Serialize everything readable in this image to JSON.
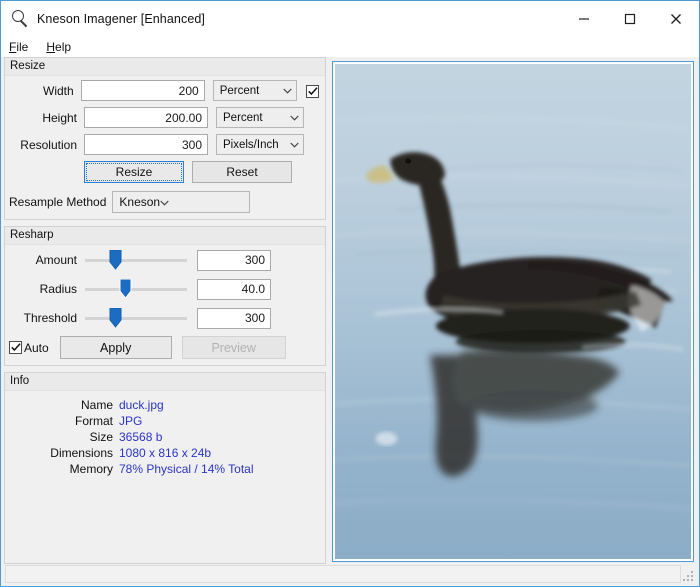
{
  "window": {
    "title": "Kneson Imagener [Enhanced]",
    "icon": "magnifier-icon",
    "controls": {
      "minimize": "minimize",
      "maximize": "maximize",
      "close": "close"
    }
  },
  "menubar": {
    "items": [
      {
        "label": "File",
        "mnemonic": "F"
      },
      {
        "label": "Help",
        "mnemonic": "H"
      }
    ]
  },
  "resize_panel": {
    "title": "Resize",
    "fields": [
      {
        "label": "Width",
        "value": "200",
        "unit": "Percent"
      },
      {
        "label": "Height",
        "value": "200.00",
        "unit": "Percent"
      },
      {
        "label": "Resolution",
        "value": "300",
        "unit": "Pixels/Inch"
      }
    ],
    "link_checkbox": {
      "name": "maintain-aspect-ratio",
      "checked": true
    },
    "buttons": {
      "resize": "Resize",
      "reset": "Reset"
    },
    "resample": {
      "label": "Resample Method",
      "value": "Kneson"
    }
  },
  "resharp_panel": {
    "title": "Resharp",
    "sliders": [
      {
        "label": "Amount",
        "value": "300",
        "pos": 26
      },
      {
        "label": "Radius",
        "value": "40.0",
        "pos": 36
      },
      {
        "label": "Threshold",
        "value": "300",
        "pos": 26
      }
    ],
    "auto": {
      "label": "Auto",
      "checked": true
    },
    "apply_label": "Apply",
    "preview_label": "Preview",
    "preview_disabled": true
  },
  "info_panel": {
    "title": "Info",
    "rows": [
      {
        "label": "Name",
        "value": "duck.jpg"
      },
      {
        "label": "Format",
        "value": "JPG"
      },
      {
        "label": "Size",
        "value": "36568 b"
      },
      {
        "label": "Dimensions",
        "value": "1080 x 816 x 24b"
      },
      {
        "label": "Memory",
        "value": "78% Physical / 14% Total"
      }
    ],
    "value_color": "#2a34c8"
  },
  "image_panel": {
    "name": "image-preview",
    "subject": "duck-on-water",
    "water_color_top": "#b9cddc",
    "water_color_bottom": "#8fb3cb",
    "duck_color": "#241f1c",
    "bill_color": "#cfc98f"
  },
  "statusbar": {
    "text": ""
  },
  "theme": {
    "accent": "#2a7fd4",
    "panel_bg": "#f0f0f0",
    "link_text": "#2a34c8"
  }
}
